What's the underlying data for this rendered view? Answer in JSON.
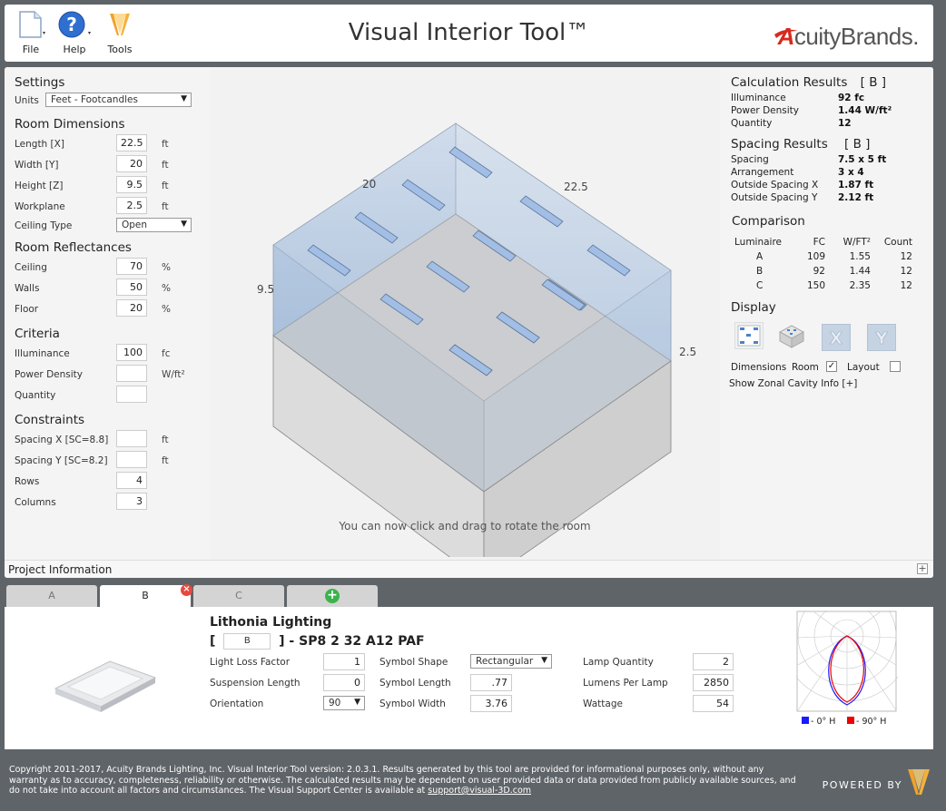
{
  "toolbar": {
    "file": "File",
    "help": "Help",
    "tools": "Tools"
  },
  "app_title": "Visual Interior Tool™",
  "brand": {
    "prefix": "A",
    "name": "cuityBrands",
    "suffix": "."
  },
  "settings": {
    "title": "Settings",
    "units_label": "Units",
    "units_value": "Feet - Footcandles"
  },
  "room_dimensions": {
    "title": "Room Dimensions",
    "length_label": "Length [X]",
    "length_value": "22.5",
    "width_label": "Width [Y]",
    "width_value": "20",
    "height_label": "Height [Z]",
    "height_value": "9.5",
    "workplane_label": "Workplane",
    "workplane_value": "2.5",
    "ceiling_type_label": "Ceiling Type",
    "ceiling_type_value": "Open",
    "unit_ft": "ft"
  },
  "reflectances": {
    "title": "Room Reflectances",
    "ceiling_label": "Ceiling",
    "ceiling_value": "70",
    "walls_label": "Walls",
    "walls_value": "50",
    "floor_label": "Floor",
    "floor_value": "20",
    "unit": "%"
  },
  "criteria": {
    "title": "Criteria",
    "illuminance_label": "Illuminance",
    "illuminance_value": "100",
    "illuminance_unit": "fc",
    "power_density_label": "Power Density",
    "power_density_value": "",
    "power_density_unit": "W/ft²",
    "quantity_label": "Quantity",
    "quantity_value": ""
  },
  "constraints": {
    "title": "Constraints",
    "spacing_x_label": "Spacing X  [SC=8.8]",
    "spacing_x_value": "",
    "spacing_y_label": "Spacing Y  [SC=8.2]",
    "spacing_y_value": "",
    "rows_label": "Rows",
    "rows_value": "4",
    "columns_label": "Columns",
    "columns_value": "3",
    "unit_ft": "ft"
  },
  "view": {
    "dim_width": "20",
    "dim_length": "22.5",
    "dim_height": "9.5",
    "dim_workplane": "2.5",
    "hint": "You can now click and drag to rotate the room"
  },
  "calc_results": {
    "title": "Calculation Results",
    "tag": "[ B ]",
    "illuminance_label": "Illuminance",
    "illuminance_value": "92  fc",
    "power_density_label": "Power Density",
    "power_density_value": "1.44  W/ft²",
    "quantity_label": "Quantity",
    "quantity_value": "12"
  },
  "spacing_results": {
    "title": "Spacing Results",
    "tag": "[ B ]",
    "spacing_label": "Spacing",
    "spacing_value": "7.5 x 5  ft",
    "arrangement_label": "Arrangement",
    "arrangement_value": "3 x 4",
    "outside_x_label": "Outside Spacing X",
    "outside_x_value": "1.87  ft",
    "outside_y_label": "Outside Spacing Y",
    "outside_y_value": "2.12  ft"
  },
  "comparison": {
    "title": "Comparison",
    "headers": [
      "Luminaire",
      "FC",
      "W/FT²",
      "Count"
    ],
    "rows": [
      [
        "A",
        "109",
        "1.55",
        "12"
      ],
      [
        "B",
        "92",
        "1.44",
        "12"
      ],
      [
        "C",
        "150",
        "2.35",
        "12"
      ]
    ]
  },
  "display": {
    "title": "Display",
    "dimensions_label": "Dimensions",
    "room_label": "Room",
    "layout_label": "Layout",
    "room_checked": "✓",
    "zonal_link": "Show Zonal Cavity Info [+]"
  },
  "project_info": "Project Information",
  "tabs": [
    "A",
    "B",
    "C"
  ],
  "luminaire": {
    "manufacturer": "Lithonia Lighting",
    "open_bracket": "[",
    "tag": "B",
    "model": "] - SP8 2 32 A12 PAF",
    "llf_label": "Light Loss Factor",
    "llf_value": "1",
    "suspension_label": "Suspension Length",
    "suspension_value": "0",
    "orientation_label": "Orientation",
    "orientation_value": "90",
    "symbol_shape_label": "Symbol Shape",
    "symbol_shape_value": "Rectangular",
    "symbol_length_label": "Symbol Length",
    "symbol_length_value": ".77",
    "symbol_width_label": "Symbol Width",
    "symbol_width_value": "3.76",
    "lamp_qty_label": "Lamp Quantity",
    "lamp_qty_value": "2",
    "lumens_label": "Lumens Per Lamp",
    "lumens_value": "2850",
    "wattage_label": "Wattage",
    "wattage_value": "54",
    "legend_0h": "- 0° H",
    "legend_90h": "- 90° H"
  },
  "footer": {
    "text": "Copyright 2011-2017, Acuity Brands Lighting, Inc. Visual Interior Tool version: 2.0.3.1. Results generated by this tool are provided for informational purposes only, without any warranty as to accuracy, completeness, reliability or otherwise. The calculated results may be dependent on user provided data or data provided from publicly available sources, and do not take into account all factors and circumstances. The Visual Support Center is available at",
    "email": "support@visual-3D.com",
    "powered_by": "POWERED BY"
  },
  "colors": {
    "accent_red": "#d52b1e",
    "tab_green": "#3ab44a",
    "fixture_blue": "#8fb2e0",
    "background": "#5f6468"
  }
}
